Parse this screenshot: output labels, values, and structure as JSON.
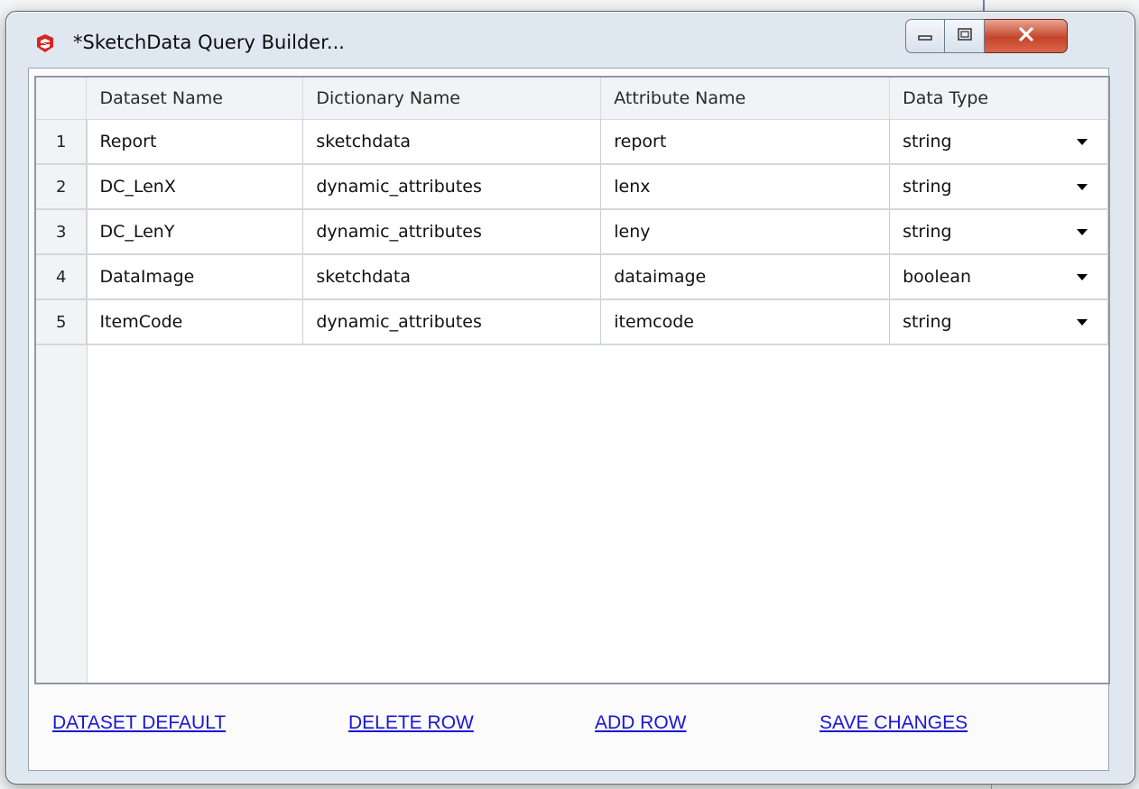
{
  "window": {
    "title": "*SketchData Query Builder...",
    "accent_close": "#c5452c"
  },
  "grid": {
    "columns": [
      "Dataset Name",
      "Dictionary Name",
      "Attribute Name",
      "Data Type"
    ],
    "rows": [
      {
        "num": "1",
        "dataset": "Report",
        "dictionary": "sketchdata",
        "attribute": "report",
        "type": "string"
      },
      {
        "num": "2",
        "dataset": "DC_LenX",
        "dictionary": "dynamic_attributes",
        "attribute": "lenx",
        "type": "string"
      },
      {
        "num": "3",
        "dataset": "DC_LenY",
        "dictionary": "dynamic_attributes",
        "attribute": "leny",
        "type": "string"
      },
      {
        "num": "4",
        "dataset": "DataImage",
        "dictionary": "sketchdata",
        "attribute": "dataimage",
        "type": "boolean"
      },
      {
        "num": "5",
        "dataset": "ItemCode",
        "dictionary": "dynamic_attributes",
        "attribute": "itemcode",
        "type": "string"
      }
    ]
  },
  "actions": {
    "dataset_default": "DATASET DEFAULT",
    "delete_row": "DELETE ROW",
    "add_row": "ADD ROW",
    "save_changes": "SAVE CHANGES"
  }
}
